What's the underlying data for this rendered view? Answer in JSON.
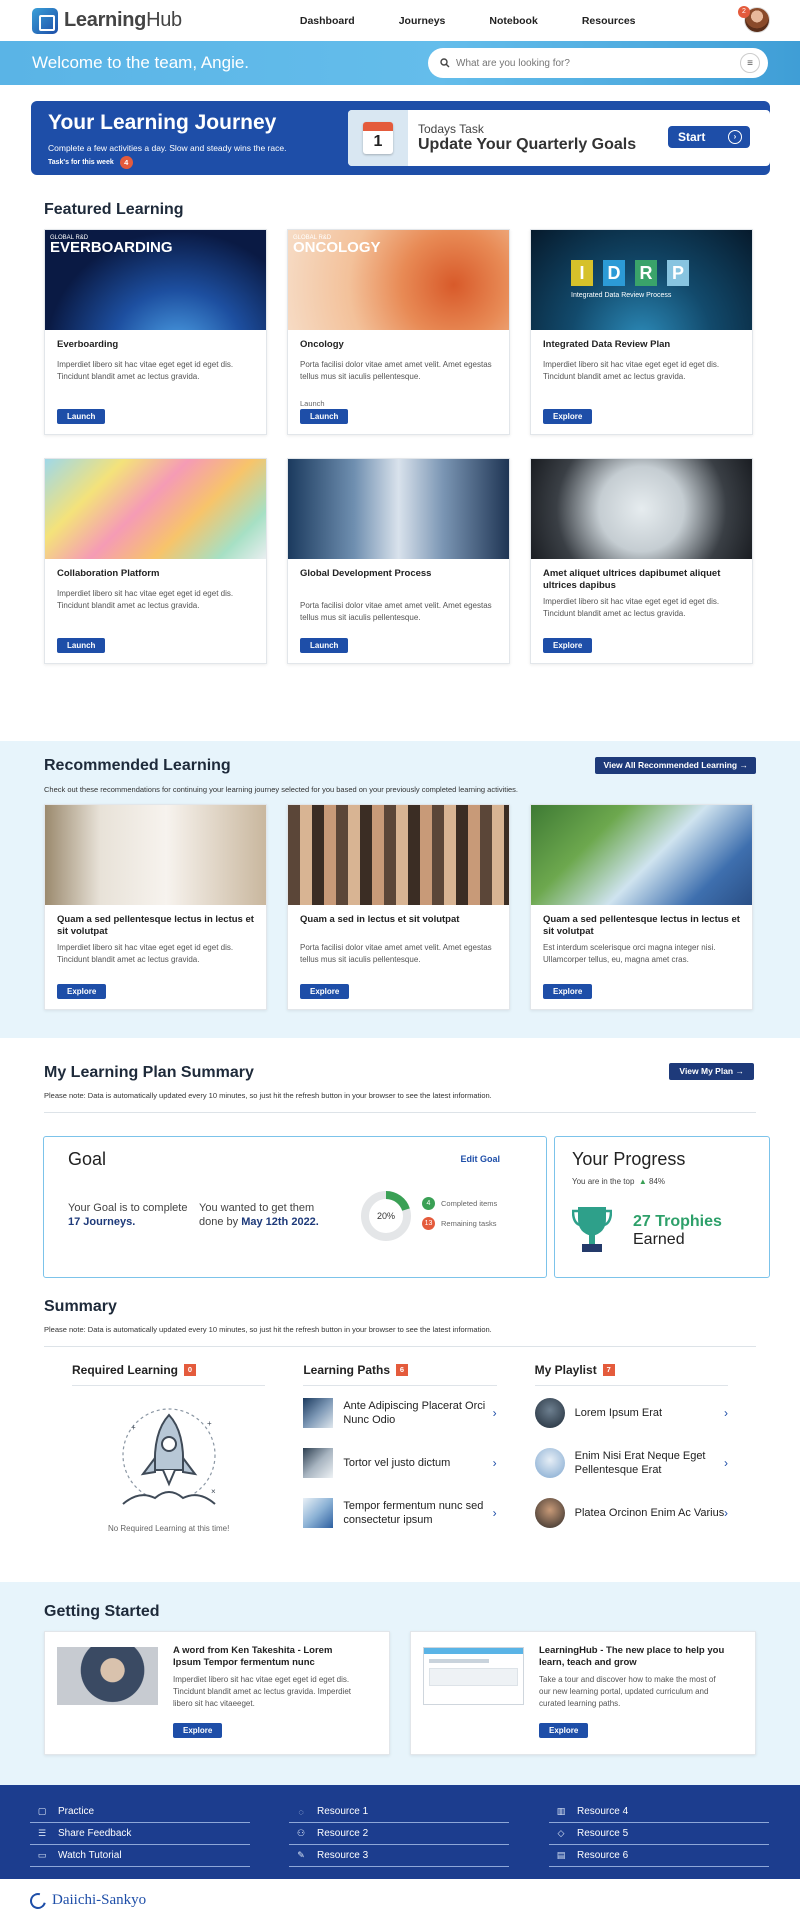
{
  "header": {
    "logo_bold": "Learning",
    "logo_light": "Hub",
    "nav": [
      "Dashboard",
      "Journeys",
      "Notebook",
      "Resources"
    ],
    "notification_count": "2"
  },
  "welcome": {
    "text": "Welcome to the team, Angie.",
    "search_placeholder": "What are you looking for?"
  },
  "journey": {
    "title": "Your Learning Journey",
    "subtitle": "Complete a few activities a day. Slow and steady wins the race.",
    "tasks_label": "Task's for this week",
    "tasks_count": "4",
    "task_heading": "Todays Task",
    "task_title": "Update Your Quarterly Goals",
    "calendar_day": "1",
    "start_label": "Start"
  },
  "featured": {
    "title": "Featured Learning",
    "cards": [
      {
        "overlay_small": "GLOBAL R&D",
        "overlay_big": "EVERBOARDING",
        "title": "Everboarding",
        "desc": "Imperdiet libero sit hac vitae eget eget id eget dis. Tincidunt blandit amet ac lectus gravida.",
        "button": "Launch"
      },
      {
        "overlay_small": "GLOBAL R&D",
        "overlay_big": "ONCOLOGY",
        "title": "Oncology",
        "desc": "Porta facilisi dolor vitae amet amet velit. Amet egestas tellus mus sit iaculis pellentesque.",
        "extra": "Launch",
        "button": "Launch"
      },
      {
        "overlay_letters": [
          "I",
          "D",
          "R",
          "P"
        ],
        "overlay_caption": "Integrated Data Review Process",
        "title": "Integrated Data Review Plan",
        "desc": "Imperdiet libero sit hac vitae eget eget id eget dis. Tincidunt blandit amet ac lectus gravida.",
        "button": "Explore"
      },
      {
        "title": "Collaboration Platform",
        "desc": "Imperdiet libero sit hac vitae eget eget id eget dis. Tincidunt blandit amet ac lectus gravida.",
        "button": "Launch"
      },
      {
        "title": "Global Development Process",
        "desc": "Porta facilisi dolor vitae amet amet velit. Amet egestas tellus mus sit iaculis pellentesque.",
        "button": "Launch"
      },
      {
        "title": "Amet aliquet ultrices dapibumet aliquet ultrices dapibus",
        "desc": "Imperdiet libero sit hac vitae eget eget id eget dis. Tincidunt blandit amet ac lectus gravida.",
        "button": "Explore"
      }
    ]
  },
  "recommended": {
    "title": "Recommended Learning",
    "view_all": "View All Recommended Learning",
    "intro": "Check out these recommendations for continuing your learning journey selected for you based on your previously completed learning activities.",
    "cards": [
      {
        "title": "Quam a sed pellentesque lectus in lectus et sit volutpat",
        "desc": "Imperdiet libero sit hac vitae eget eget id eget dis. Tincidunt blandit amet ac lectus gravida.",
        "button": "Explore"
      },
      {
        "title": "Quam a sed in lectus et sit volutpat",
        "desc": "Porta facilisi dolor vitae amet amet velit. Amet egestas tellus mus sit iaculis pellentesque.",
        "button": "Explore"
      },
      {
        "title": "Quam a sed pellentesque lectus in lectus et sit volutpat",
        "desc": "Est interdum scelerisque orci magna integer nisi. Ullamcorper tellus, eu, magna amet cras.",
        "button": "Explore"
      }
    ]
  },
  "plan": {
    "title": "My Learning Plan Summary",
    "view_plan": "View My Plan",
    "note": "Please note: Data is automatically updated every 10 minutes, so just hit the refresh button in your browser to see the latest information.",
    "goal": {
      "title": "Goal",
      "edit": "Edit Goal",
      "goal_prefix": "Your Goal is to complete ",
      "goal_value": "17 Journeys.",
      "date_prefix": "You wanted to get them done by ",
      "date_value": "May 12th 2022.",
      "percent_label": "20%",
      "percent_value": 0.2,
      "completed_count": "4",
      "completed_label": "Completed items",
      "remaining_count": "13",
      "remaining_label": "Remaining tasks"
    },
    "progress": {
      "title": "Your Progress",
      "top_text": "You are in the top",
      "top_value": "84%",
      "trophies": "27 Trophies",
      "earned": "Earned"
    }
  },
  "summary": {
    "title": "Summary",
    "note": "Please note: Data is automatically updated every 10 minutes, so just hit the refresh button in your browser to see the latest information.",
    "required": {
      "title": "Required Learning",
      "count": "0",
      "empty": "No Required Learning at this time!"
    },
    "paths": {
      "title": "Learning Paths",
      "count": "6",
      "items": [
        "Ante Adipiscing Placerat Orci Nunc Odio",
        "Tortor vel justo dictum",
        "Tempor fermentum nunc sed consectetur ipsum"
      ]
    },
    "playlist": {
      "title": "My Playlist",
      "count": "7",
      "items": [
        "Lorem Ipsum Erat",
        "Enim Nisi Erat Neque Eget Pellentesque Erat",
        "Platea Orcinon Enim Ac Varius"
      ]
    }
  },
  "getting_started": {
    "title": "Getting Started",
    "cards": [
      {
        "title": "A word from Ken Takeshita - Lorem Ipsum Tempor fermentum nunc",
        "desc": "Imperdiet libero sit hac vitae eget eget id eget dis. Tincidunt blandit amet ac lectus gravida. Imperdiet libero sit hac vitaeeget.",
        "button": "Explore"
      },
      {
        "title": "LearningHub - The new place to help you learn, teach and grow",
        "desc": "Take a tour and discover how to make the most of our new learning portal, updated curriculum and curated learning paths.",
        "button": "Explore"
      }
    ]
  },
  "footer": {
    "col1": [
      "Practice",
      "Share Feedback",
      "Watch Tutorial"
    ],
    "col2": [
      "Resource 1",
      "Resource 2",
      "Resource 3"
    ],
    "col3": [
      "Resource 4",
      "Resource 5",
      "Resource 6"
    ],
    "brand": "Daiichi-Sankyo"
  },
  "colors": {
    "primary": "#1e4ea8",
    "accent_red": "#e45b3c",
    "sky": "#5ab4e6",
    "success": "#3aa055",
    "pale_bg": "#e7f4fb"
  }
}
